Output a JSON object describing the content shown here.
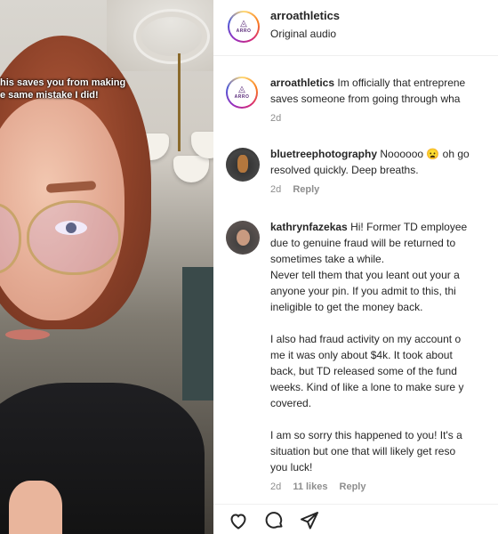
{
  "video": {
    "caption_lines": [
      "his saves you from making",
      "e same mistake I did!"
    ]
  },
  "post": {
    "username": "arroathletics",
    "audio": "Original audio",
    "logo_text": "ARRO"
  },
  "comments": [
    {
      "username": "arroathletics",
      "lines": [
        "Im officially that entreprene",
        "saves someone from going through wha"
      ],
      "time": "2d",
      "likes": "",
      "reply": ""
    },
    {
      "username": "bluetreephotography",
      "lines": [
        "Noooooo 😦 oh go",
        "resolved quickly. Deep breaths."
      ],
      "time": "2d",
      "likes": "",
      "reply": "Reply"
    },
    {
      "username": "kathrynfazekas",
      "lines": [
        "Hi! Former TD employee",
        "due to genuine fraud will be returned to",
        "sometimes take a while.",
        "Never tell them that you leant out your a",
        "anyone your pin. If you admit to this, thi",
        "ineligible to get the money back.",
        "",
        "I also had fraud activity on my account o",
        "me it was only about $4k. It took about",
        "back, but TD released some of the fund",
        "weeks. Kind of like a lone to make sure y",
        "covered.",
        "",
        "I am so sorry this happened to you! It's a",
        "situation but one that will likely get reso",
        "you luck!"
      ],
      "time": "2d",
      "likes": "11 likes",
      "reply": "Reply"
    }
  ],
  "actions": {
    "like_icon": "heart-icon",
    "comment_icon": "comment-icon",
    "share_icon": "share-icon"
  }
}
